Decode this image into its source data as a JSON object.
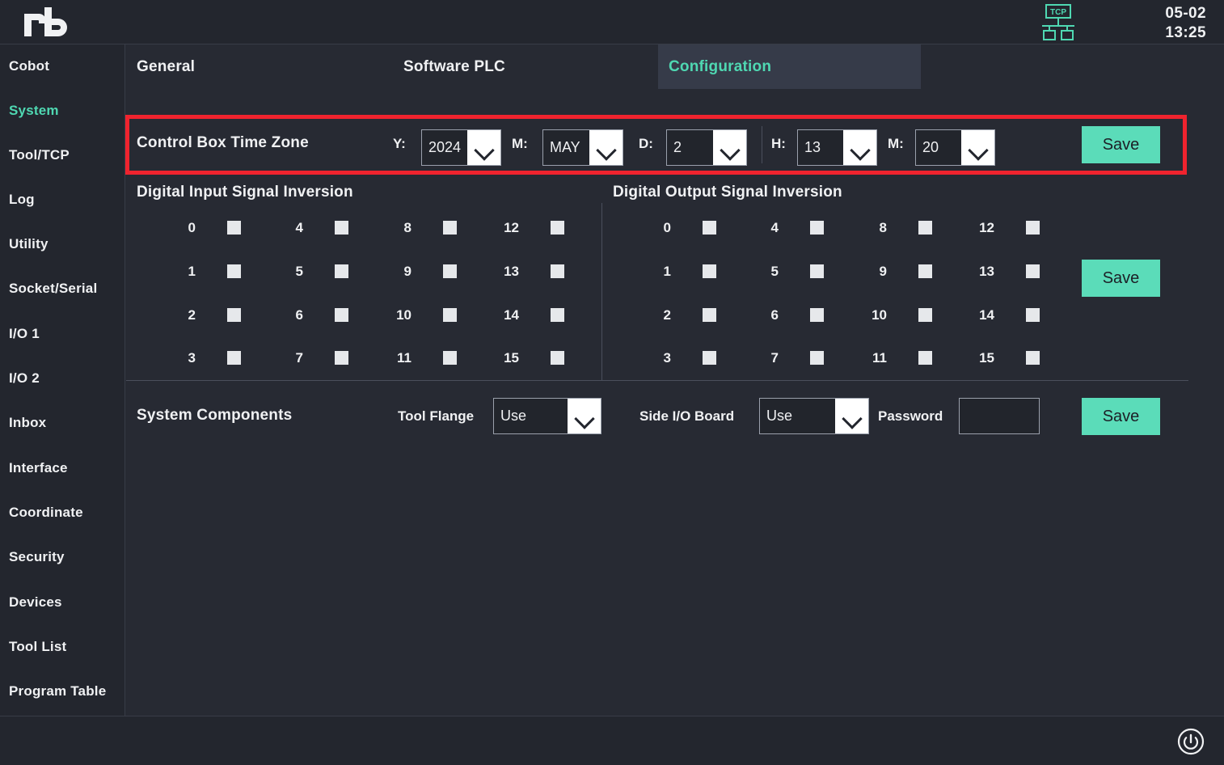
{
  "header": {
    "logo_text": "rb",
    "network_icon": "tcp-network-icon",
    "network_label": "TCP",
    "date": "05-02",
    "time": "13:25"
  },
  "sidebar": {
    "items": [
      {
        "label": "Cobot",
        "active": false
      },
      {
        "label": "System",
        "active": true
      },
      {
        "label": "Tool/TCP",
        "active": false
      },
      {
        "label": "Log",
        "active": false
      },
      {
        "label": "Utility",
        "active": false
      },
      {
        "label": "Socket/Serial",
        "active": false
      },
      {
        "label": "I/O 1",
        "active": false
      },
      {
        "label": "I/O 2",
        "active": false
      },
      {
        "label": "Inbox",
        "active": false
      },
      {
        "label": "Interface",
        "active": false
      },
      {
        "label": "Coordinate",
        "active": false
      },
      {
        "label": "Security",
        "active": false
      },
      {
        "label": "Devices",
        "active": false
      },
      {
        "label": "Tool List",
        "active": false
      },
      {
        "label": "Program Table",
        "active": false
      }
    ]
  },
  "tabs": [
    {
      "label": "General",
      "active": false
    },
    {
      "label": "Software PLC",
      "active": false
    },
    {
      "label": "Configuration",
      "active": true
    }
  ],
  "timezone": {
    "section_label": "Control Box Time Zone",
    "fields": [
      {
        "label": "Y:",
        "value": "2024"
      },
      {
        "label": "M:",
        "value": "MAY"
      },
      {
        "label": "D:",
        "value": "2"
      },
      {
        "label": "H:",
        "value": "13"
      },
      {
        "label": "M:",
        "value": "20"
      }
    ],
    "save_label": "Save",
    "highlight_color": "#F0232E"
  },
  "digital_input": {
    "title": "Digital Input Signal Inversion",
    "columns": [
      [
        "0",
        "1",
        "2",
        "3"
      ],
      [
        "4",
        "5",
        "6",
        "7"
      ],
      [
        "8",
        "9",
        "10",
        "11"
      ],
      [
        "12",
        "13",
        "14",
        "15"
      ]
    ],
    "checked": false
  },
  "digital_output": {
    "title": "Digital Output Signal Inversion",
    "columns": [
      [
        "0",
        "1",
        "2",
        "3"
      ],
      [
        "4",
        "5",
        "6",
        "7"
      ],
      [
        "8",
        "9",
        "10",
        "11"
      ],
      [
        "12",
        "13",
        "14",
        "15"
      ]
    ],
    "checked": false,
    "save_label": "Save"
  },
  "system_components": {
    "title": "System Components",
    "tool_flange": {
      "label": "Tool Flange",
      "value": "Use"
    },
    "side_io_board": {
      "label": "Side I/O Board",
      "value": "Use"
    },
    "password": {
      "label": "Password",
      "value": "",
      "placeholder": ""
    },
    "save_label": "Save"
  },
  "footer": {
    "power_icon": "power-icon"
  },
  "colors": {
    "accent": "#4FD8B2",
    "save_button": "#5BDCB9",
    "highlight": "#F0232E",
    "background": "#272A33",
    "panel": "#23262E",
    "tab_active_bg": "#363B49"
  }
}
